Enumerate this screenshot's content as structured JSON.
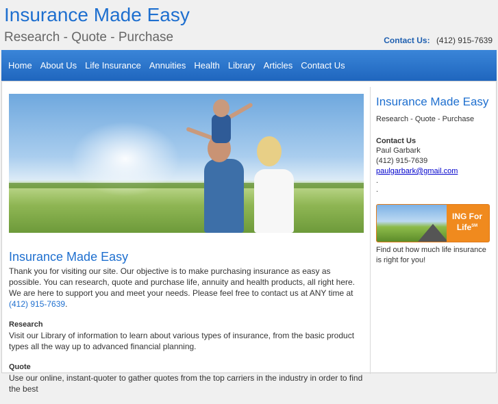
{
  "header": {
    "title": "Insurance Made Easy",
    "tagline": "Research - Quote - Purchase",
    "contact_label": "Contact Us:",
    "contact_phone": "(412) 915-7639"
  },
  "nav": {
    "items": [
      "Home",
      "About Us",
      "Life Insurance",
      "Annuities",
      "Health",
      "Library",
      "Articles",
      "Contact Us"
    ]
  },
  "main": {
    "heading": "Insurance Made Easy",
    "intro": "Thank you for visiting our site.  Our objective is to make purchasing insurance as easy as possible.  You can research, quote and purchase life, annuity and health products, all right here.  We are here to support you and meet your needs.  Please feel free to contact us at ANY time at",
    "intro_phone": "(412) 915-7639",
    "intro_end": ".",
    "research_heading": "Research",
    "research_text": "Visit our Library of information to learn about various types of insurance, from the basic product types all the way up to advanced financial planning.",
    "quote_heading": "Quote",
    "quote_text": "Use our online, instant-quoter to gather quotes from the top carriers in the industry in order to find the best"
  },
  "sidebar": {
    "title": "Insurance Made Easy",
    "tagline": "Research - Quote - Purchase",
    "contact_heading": "Contact Us",
    "contact_name": "Paul Garbark",
    "contact_phone": "(412) 915-7639",
    "contact_email": "paulgarbark@gmail.com",
    "dot1": ".",
    "dot2": ".",
    "banner_text_1": "ING For",
    "banner_text_2": "Life",
    "banner_sm": "SM",
    "banner_caption": "Find out how much life insurance is right for you!"
  },
  "colors": {
    "accent": "#1e6fcf",
    "nav_bg": "#2a74c9",
    "banner_orange": "#f08a1e"
  }
}
